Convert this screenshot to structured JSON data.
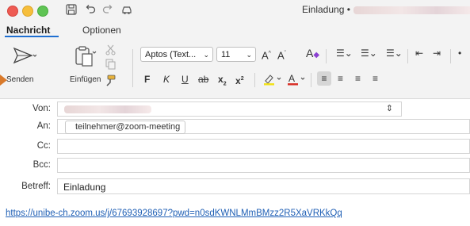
{
  "window": {
    "title": "Einladung •"
  },
  "tabs": [
    {
      "label": "Nachricht"
    },
    {
      "label": "Optionen"
    }
  ],
  "ribbon": {
    "send_label": "Senden",
    "paste_label": "Einfügen",
    "font_name": "Aptos (Text...",
    "font_size": "11",
    "bold": "F",
    "italic": "K",
    "underline": "U",
    "strike": "ab",
    "subscript": "x",
    "superscript": "x",
    "grow_font": "A",
    "shrink_font": "A"
  },
  "fields": {
    "from_label": "Von:",
    "to_label": "An:",
    "to_value": "teilnehmer@zoom-meeting",
    "cc_label": "Cc:",
    "bcc_label": "Bcc:",
    "subject_label": "Betreff:",
    "subject_value": "Einladung"
  },
  "body": {
    "link": "https://unibe-ch.zoom.us/j/67693928697?pwd=n0sdKWNLMmBMzz2R5XaVRKkQq"
  },
  "colors": {
    "accent": "#1f6fd1",
    "link": "#1f5fb5",
    "traffic_red": "#ee5b53",
    "traffic_yellow": "#f6be3b",
    "traffic_green": "#5fc454"
  },
  "icons": [
    "save-icon",
    "undo-icon",
    "redo-icon",
    "car-icon",
    "send-icon",
    "paste-icon",
    "cut-icon",
    "copy-icon",
    "format-painter-icon"
  ]
}
